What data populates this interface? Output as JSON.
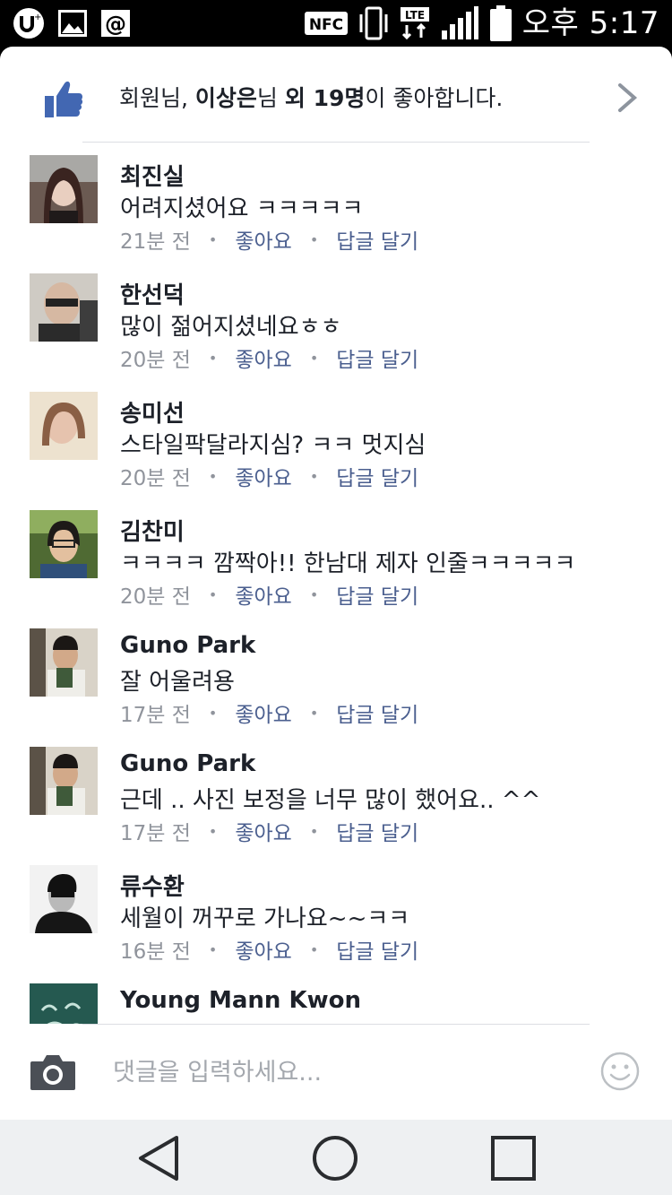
{
  "status_bar": {
    "time": "오후 5:17",
    "icons": [
      "uplus-icon",
      "gallery-icon",
      "at-icon",
      "nfc-icon",
      "vibrate-icon",
      "lte-icon",
      "signal-icon",
      "battery-icon"
    ],
    "nfc_label": "NFC",
    "lte_label": "LTE"
  },
  "likes": {
    "prefix": "회원님, ",
    "name": "이상은",
    "mid": "님 ",
    "others": "외 19명",
    "suffix": "이 좋아합니다.",
    "icon": "thumbs-up-icon",
    "accent": "#4267b2"
  },
  "comments": [
    {
      "name": "최진실",
      "text": "어려지셨어요 ㅋㅋㅋㅋㅋ",
      "time": "21분 전",
      "like": "좋아요",
      "reply": "답글 달기"
    },
    {
      "name": "한선덕",
      "text": "많이 젊어지셨네요ㅎㅎ",
      "time": "20분 전",
      "like": "좋아요",
      "reply": "답글 달기"
    },
    {
      "name": "송미선",
      "text": "스타일팍달라지심? ㅋㅋ 멋지심",
      "time": "20분 전",
      "like": "좋아요",
      "reply": "답글 달기"
    },
    {
      "name": "김찬미",
      "text": "ㅋㅋㅋㅋ 깜짝아!! 한남대 제자 인줄ㅋㅋㅋㅋㅋ",
      "time": "20분 전",
      "like": "좋아요",
      "reply": "답글 달기"
    },
    {
      "name": "Guno Park",
      "text": "잘 어울려용",
      "time": "17분 전",
      "like": "좋아요",
      "reply": "답글 달기"
    },
    {
      "name": "Guno Park",
      "text": "근데 .. 사진 보정을 너무 많이 했어요.. ^^",
      "time": "17분 전",
      "like": "좋아요",
      "reply": "답글 달기"
    },
    {
      "name": "류수환",
      "text": "세월이 꺼꾸로 가나요~~ㅋㅋ",
      "time": "16분 전",
      "like": "좋아요",
      "reply": "답글 달기"
    },
    {
      "name": "Young Mann Kwon",
      "text": "",
      "time": "",
      "like": "",
      "reply": ""
    }
  ],
  "composer": {
    "placeholder": "댓글을 입력하세요...",
    "camera_icon": "camera-icon",
    "emoji_icon": "smiley-icon"
  },
  "nav_bar": {
    "buttons": [
      "back-icon",
      "home-icon",
      "recents-icon"
    ]
  },
  "colors": {
    "link": "#4b5f8f",
    "meta": "#90949c",
    "text": "#1d2129"
  }
}
